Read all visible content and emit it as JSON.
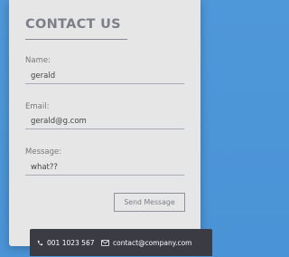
{
  "contact_form": {
    "title": "CONTACT US",
    "name": {
      "label": "Name:",
      "value": "gerald"
    },
    "email": {
      "label": "Email:",
      "value": "gerald@g.com"
    },
    "message": {
      "label": "Message:",
      "value": "what??"
    },
    "send_label": "Send Message"
  },
  "footer": {
    "phone": "001 1023 567",
    "email": "contact@company.com",
    "icons": {
      "phone": "phone-icon",
      "email": "envelope-icon"
    }
  },
  "colors": {
    "background": "#4e97d8",
    "card": "#e6e6e6",
    "title": "#7c7e88",
    "footer_bar": "#3a3b43"
  }
}
